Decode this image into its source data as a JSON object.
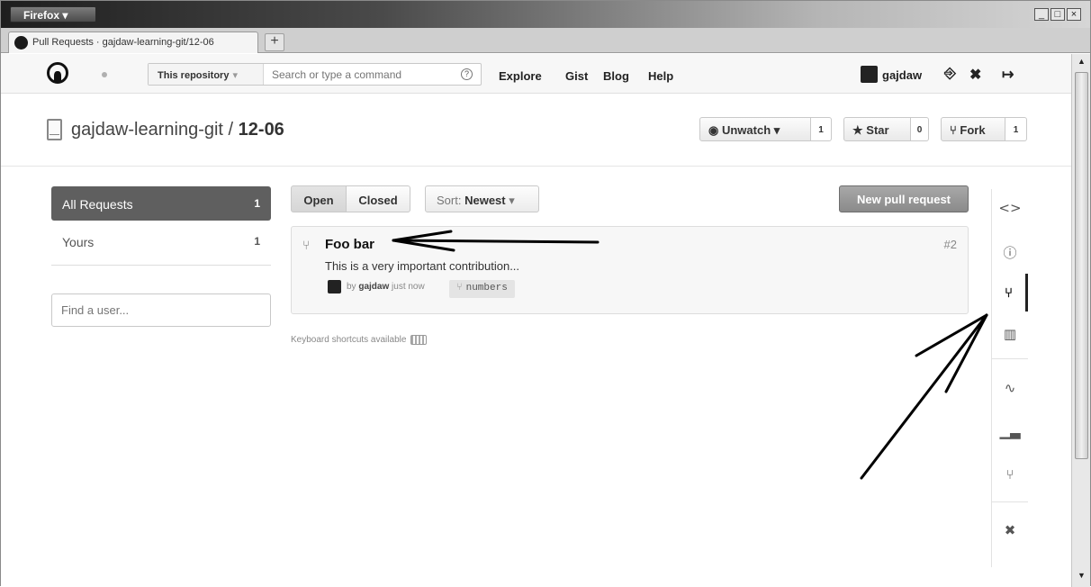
{
  "browser": {
    "menu_label": "Firefox ▾",
    "window_controls": [
      "_",
      "□",
      "×"
    ],
    "tab_title": "Pull Requests · gajdaw-learning-git/12-06",
    "new_tab_label": "+"
  },
  "header": {
    "scope_label": "This repository",
    "scope_caret": "▾",
    "search_placeholder": "Search or type a command",
    "search_help": "?",
    "nav": [
      "Explore",
      "Gist",
      "Blog",
      "Help"
    ],
    "username": "gajdaw",
    "icons": [
      "create-repo-icon",
      "settings-tools-icon",
      "sign-out-icon"
    ]
  },
  "repo": {
    "owner": "gajdaw-learning-git",
    "separator": " / ",
    "name": "12-06",
    "unwatch_label": "Unwatch",
    "unwatch_count": "1",
    "star_label": "Star",
    "star_count": "0",
    "fork_label": "Fork",
    "fork_count": "1"
  },
  "filters": {
    "all_label": "All Requests",
    "all_count": "1",
    "yours_label": "Yours",
    "yours_count": "1",
    "find_user_placeholder": "Find a user..."
  },
  "toolbar": {
    "open_label": "Open",
    "closed_label": "Closed",
    "sort_prefix": "Sort:",
    "sort_value": "Newest",
    "sort_caret": "▾",
    "new_pr_label": "New pull request"
  },
  "pull_requests": [
    {
      "title": "Foo bar",
      "number": "#2",
      "description": "This is a very important contribution...",
      "by_prefix": "by",
      "author": "gajdaw",
      "time": "just now",
      "branch": "numbers"
    }
  ],
  "footer": {
    "keyboard_hint": "Keyboard shortcuts available"
  },
  "sidenav": {
    "items": [
      "code-icon",
      "issues-icon",
      "pull-requests-icon",
      "wiki-icon",
      "pulse-icon",
      "graphs-icon",
      "network-icon",
      "settings-icon"
    ],
    "active": "pull-requests-icon"
  },
  "colors": {
    "selected_filter_bg": "#5f5f5f",
    "new_pr_button_bg": "#999999",
    "annotation_arrow": "#000000"
  }
}
